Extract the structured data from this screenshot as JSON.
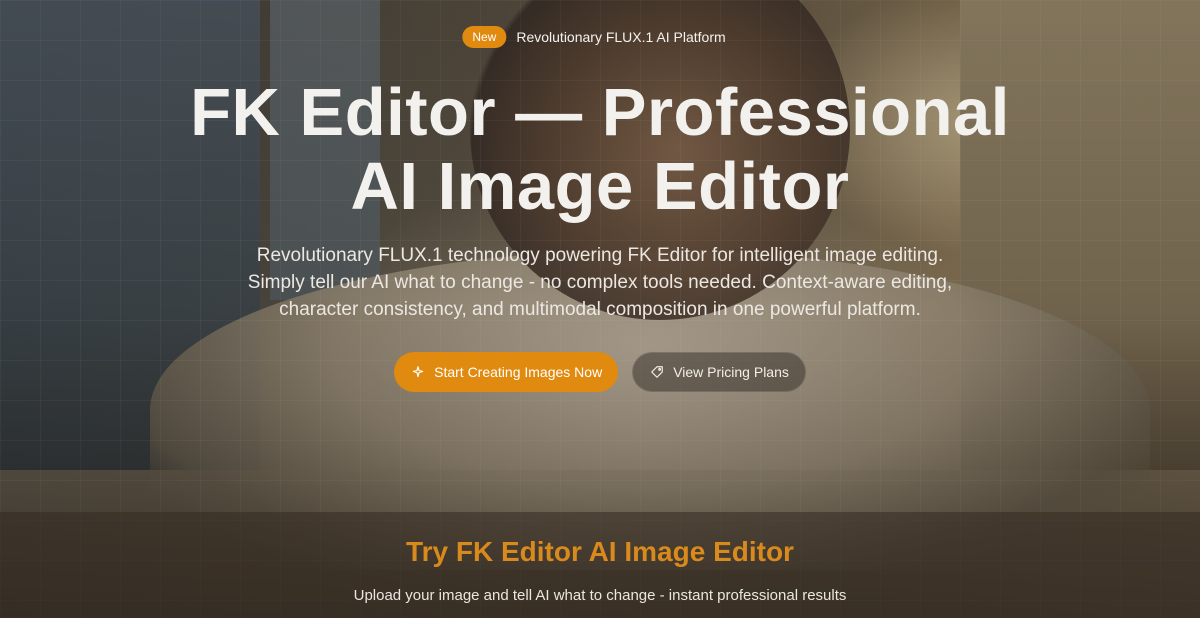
{
  "hero": {
    "badge": "New",
    "announcement": "Revolutionary FLUX.1 AI Platform",
    "title_lines": [
      "FK Editor — Professional",
      "AI Image Editor"
    ],
    "subtitle_lines": [
      "Revolutionary FLUX.1 technology powering FK Editor for intelligent image editing.",
      "Simply tell our AI what to change - no complex tools needed. Context-aware editing,",
      "character consistency, and multimodal composition in one powerful platform."
    ],
    "primary_cta": {
      "label": "Start Creating Images Now",
      "icon": "sparkle-icon"
    },
    "secondary_cta": {
      "label": "View Pricing Plans",
      "icon": "tag-icon"
    }
  },
  "try_section": {
    "title": "Try FK Editor AI Image Editor",
    "subtitle": "Upload your image and tell AI what to change - instant professional results"
  },
  "colors": {
    "accent": "#e08a0f",
    "try_title": "#d98a1c",
    "text": "#f3f1ee"
  }
}
